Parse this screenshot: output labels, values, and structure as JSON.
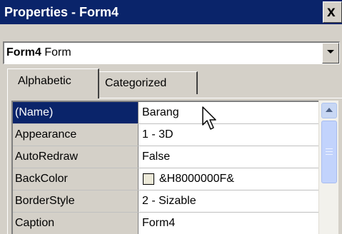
{
  "window": {
    "title": "Properties - Form4",
    "close_glyph": "x"
  },
  "object_selector": {
    "name": "Form4",
    "type": "Form"
  },
  "tabs": [
    {
      "label": "Alphabetic",
      "active": true
    },
    {
      "label": "Categorized",
      "active": false
    }
  ],
  "properties": [
    {
      "name": "(Name)",
      "value": "Barang",
      "selected": true
    },
    {
      "name": "Appearance",
      "value": "1 - 3D"
    },
    {
      "name": "AutoRedraw",
      "value": "False"
    },
    {
      "name": "BackColor",
      "value": "&H8000000F&",
      "swatch_color": "#ece9d8"
    },
    {
      "name": "BorderStyle",
      "value": "2 - Sizable"
    },
    {
      "name": "Caption",
      "value": "Form4"
    }
  ],
  "icons": {
    "close": "close-icon",
    "dropdown": "chevron-down-icon",
    "scroll_up": "chevron-up-icon",
    "cursor": "arrow-cursor-icon"
  },
  "colors": {
    "titlebar": "#0a246a",
    "selection": "#0a246a",
    "face": "#d4d0c8"
  }
}
